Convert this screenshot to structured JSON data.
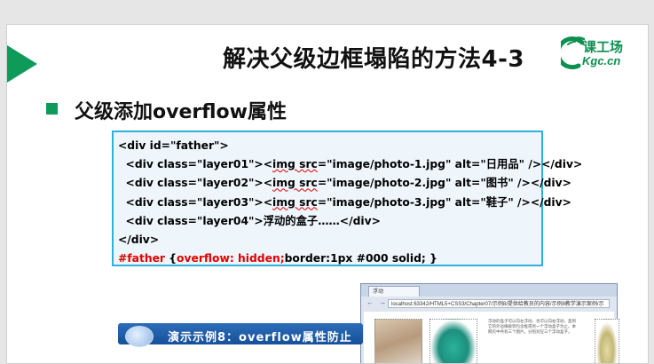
{
  "slide": {
    "title": "解决父级边框塌陷的方法4-3",
    "heading": "父级添加overflow属性"
  },
  "logo": {
    "cn": "课工场",
    "en": "Kgc.cn",
    "color": "#0d8f4f"
  },
  "code": {
    "line1": "<div id=\"father\">",
    "line2_pre": "  <div class=\"layer01\"><",
    "line2_img": "img src",
    "line2_post": "=\"image/photo-1.jpg\" alt=\"日用品\" /></div>",
    "line3_pre": "  <div class=\"layer02\"><",
    "line3_img": "img src",
    "line3_post": "=\"image/photo-2.jpg\" alt=\"图书\" /></div>",
    "line4_pre": "  <div class=\"layer03\"><",
    "line4_img": "img src",
    "line4_post": "=\"image/photo-3.jpg\" alt=\"鞋子\" /></div>",
    "line5": "  <div class=\"layer04\">浮动的盒子……</div>",
    "line6": "</div>",
    "line7_selector": "#father",
    "line7_brace": " {",
    "line7_red": "overflow: hidden;",
    "line7_rest": "border:1px #000 solid; }",
    "border_color": "#2eb1dd"
  },
  "browser": {
    "tab_title": "浮动",
    "address": "localhost:63342/HTML5+CSS3/Chapter07/示例8/提供给教员的内容/示例8教学演示案例/示",
    "sample_text": "浮动的盒子可以向左浮动，也可以向右浮动，直到它的外边缘碰到包含框或另一个浮动盒子为止。本网页中共有三个图片，分别对应三个浮动盒子。"
  },
  "demo": {
    "label": "演示示例8：overflow属性防止",
    "color": "#1f5fae"
  },
  "colors": {
    "accent": "#0e9a59",
    "code_highlight": "#e00000"
  }
}
